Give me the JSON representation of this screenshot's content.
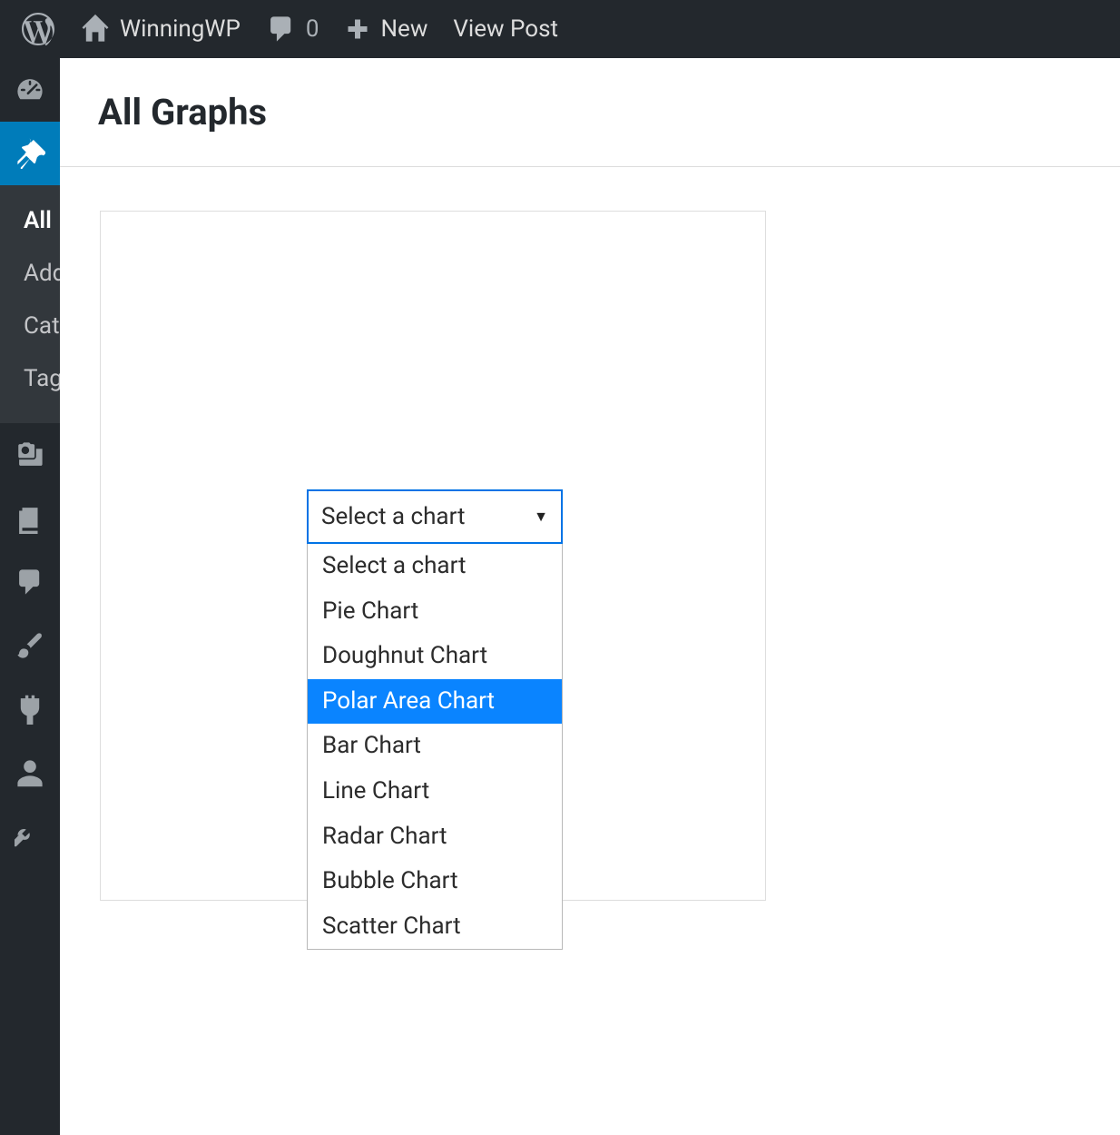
{
  "adminbar": {
    "site_name": "WinningWP",
    "comment_count": "0",
    "new_label": "New",
    "view_post": "View Post"
  },
  "sidebar": {
    "submenu": {
      "all": "All",
      "add": "Add",
      "cat": "Cat",
      "tag": "Tag"
    }
  },
  "page": {
    "title": "All Graphs"
  },
  "select": {
    "current": "Select a chart",
    "options": [
      "Select a chart",
      "Pie Chart",
      "Doughnut Chart",
      "Polar Area Chart",
      "Bar Chart",
      "Line Chart",
      "Radar Chart",
      "Bubble Chart",
      "Scatter Chart"
    ],
    "highlighted_index": 3
  }
}
